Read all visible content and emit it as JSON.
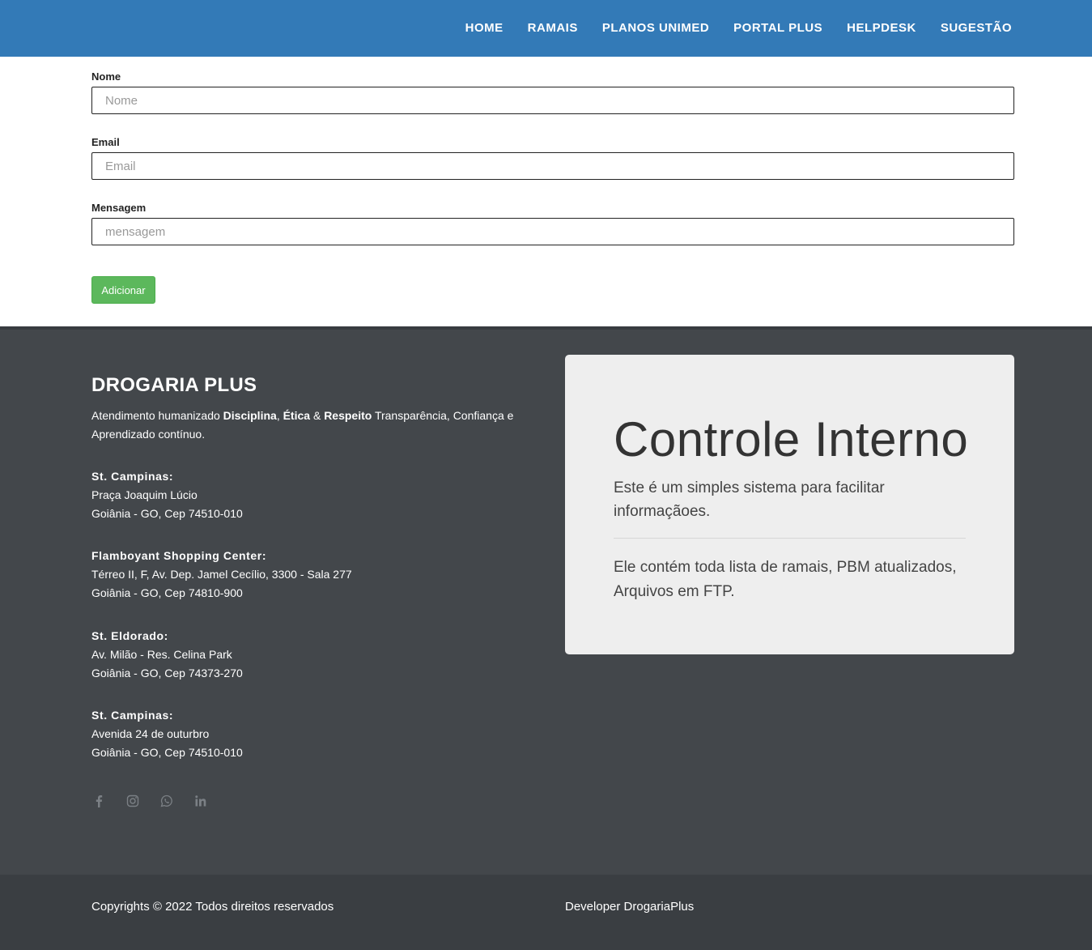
{
  "nav": {
    "items": [
      {
        "label": "HOME"
      },
      {
        "label": "RAMAIS"
      },
      {
        "label": "PLANOS UNIMED"
      },
      {
        "label": "PORTAL PLUS"
      },
      {
        "label": "HELPDESK"
      },
      {
        "label": "SUGESTÃO"
      }
    ]
  },
  "form": {
    "nome_label": "Nome",
    "nome_placeholder": "Nome",
    "email_label": "Email",
    "email_placeholder": "Email",
    "mensagem_label": "Mensagem",
    "mensagem_placeholder": "mensagem",
    "submit_label": "Adicionar"
  },
  "footer": {
    "brand": "DROGARIA PLUS",
    "tagline": {
      "t1": "Atendimento humanizado ",
      "b1": "Disciplina",
      "t2": ", ",
      "b2": "Ética",
      "t3": " & ",
      "b3": "Respeito",
      "t4": " Transparência, Confiança e Aprendizado contínuo."
    },
    "addresses": [
      {
        "title": "St. Campinas:",
        "line1": "Praça Joaquim Lúcio",
        "line2": "Goiânia - GO, Cep 74510-010"
      },
      {
        "title": "Flamboyant Shopping Center:",
        "line1": "Térreo II, F, Av. Dep. Jamel Cecílio, 3300 - Sala 277",
        "line2": "Goiânia - GO, Cep 74810-900"
      },
      {
        "title": "St. Eldorado:",
        "line1": "Av. Milão - Res. Celina Park",
        "line2": "Goiânia - GO, Cep 74373-270"
      },
      {
        "title": "St. Campinas:",
        "line1": "Avenida 24 de outurbro",
        "line2": "Goiânia - GO, Cep 74510-010"
      }
    ],
    "social_icons": [
      "facebook-icon",
      "instagram-icon",
      "whatsapp-icon",
      "linkedin-icon"
    ],
    "jumbotron": {
      "title": "Controle Interno",
      "lead": "Este é um simples sistema para facilitar informaçãoes.",
      "text": "Ele contém toda lista de ramais, PBM atualizados, Arquivos em FTP."
    },
    "copyright": "Copyrights © 2022 Todos direitos reservados",
    "developer": "Developer DrogariaPlus"
  },
  "colors": {
    "navbar": "#337ab7",
    "footer": "#43474b",
    "bottom_bar": "#3a3e42",
    "button": "#5cb85c",
    "jumbotron": "#eeeeee"
  }
}
